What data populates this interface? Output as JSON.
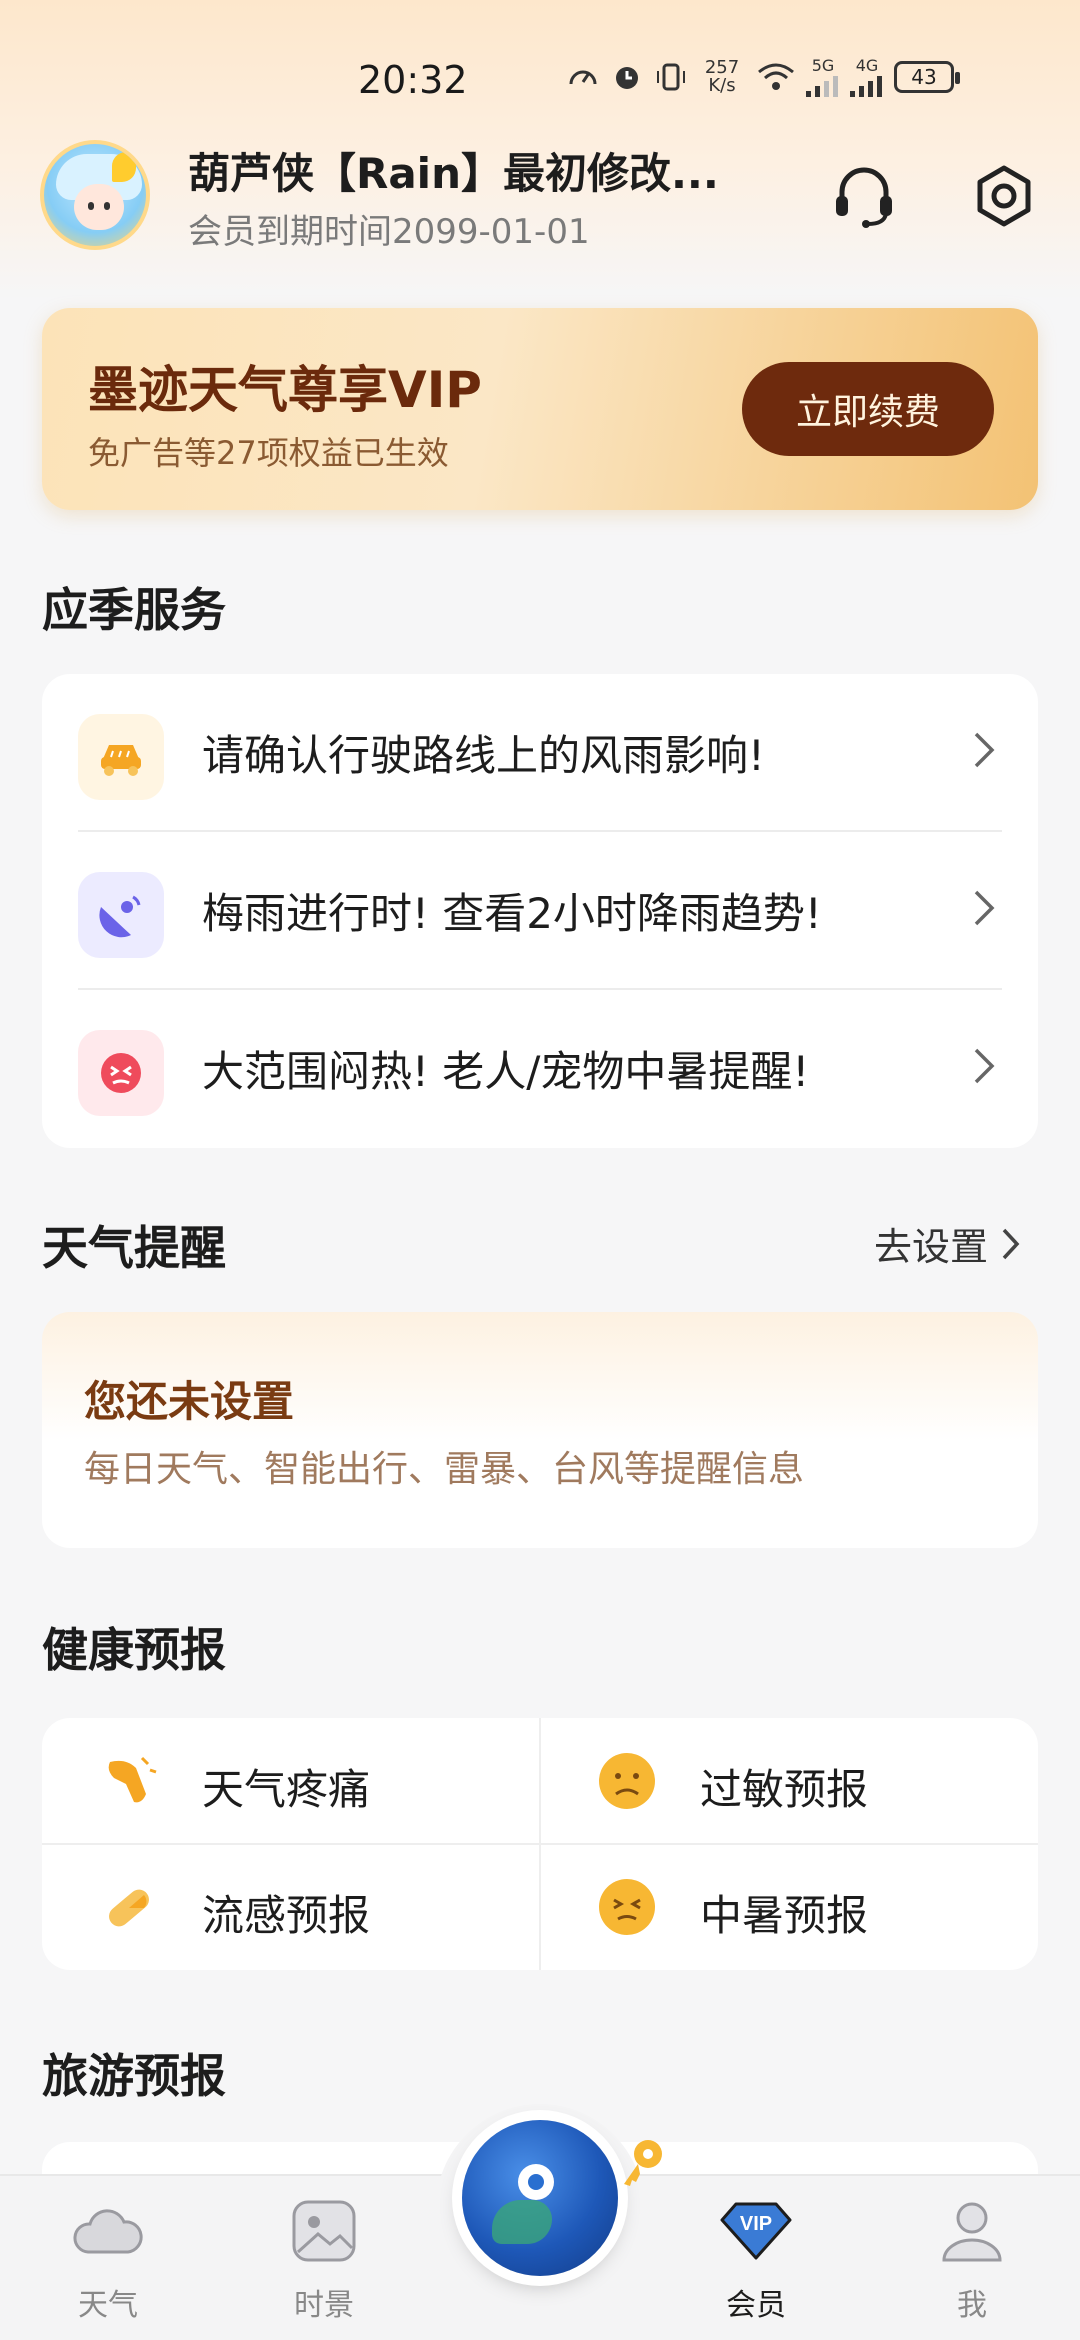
{
  "status_bar": {
    "time": "20:32",
    "net_speed_value": "257",
    "net_speed_unit": "K/s",
    "signal_1": "5G",
    "signal_2": "4G",
    "battery": "43"
  },
  "profile": {
    "name": "葫芦侠【Rain】最初修改...",
    "membership_expiry": "会员到期时间2099-01-01"
  },
  "vip_banner": {
    "title": "墨迹天气尊享VIP",
    "subtitle": "免广告等27项权益已生效",
    "button": "立即续费"
  },
  "seasonal": {
    "title": "应季服务",
    "items": [
      {
        "label": "请确认行驶路线上的风雨影响!",
        "icon": "car-rain-icon"
      },
      {
        "label": "梅雨进行时! 查看2小时降雨趋势!",
        "icon": "radar-icon"
      },
      {
        "label": "大范围闷热! 老人/宠物中暑提醒!",
        "icon": "heatstroke-face-icon"
      }
    ]
  },
  "weather_reminder": {
    "title": "天气提醒",
    "goto_settings": "去设置",
    "card_title": "您还未设置",
    "card_subtitle": "每日天气、智能出行、雷暴、台风等提醒信息"
  },
  "health": {
    "title": "健康预报",
    "items": [
      {
        "label": "天气疼痛",
        "icon": "joint-pain-icon"
      },
      {
        "label": "过敏预报",
        "icon": "allergy-face-icon"
      },
      {
        "label": "流感预报",
        "icon": "pill-icon"
      },
      {
        "label": "中暑预报",
        "icon": "heatstroke-face-icon"
      }
    ]
  },
  "travel": {
    "title": "旅游预报"
  },
  "bottom_nav": {
    "items": [
      {
        "label": "天气",
        "icon": "cloud-icon"
      },
      {
        "label": "时景",
        "icon": "photo-icon"
      },
      {
        "label": "会员",
        "icon": "vip-diamond-icon",
        "active": true
      },
      {
        "label": "我",
        "icon": "profile-icon"
      }
    ],
    "vip_badge": "VIP"
  },
  "colors": {
    "accent_brown": "#6e2a0d",
    "icon_orange": "#f5a623",
    "active_blue": "#1e58b8"
  }
}
